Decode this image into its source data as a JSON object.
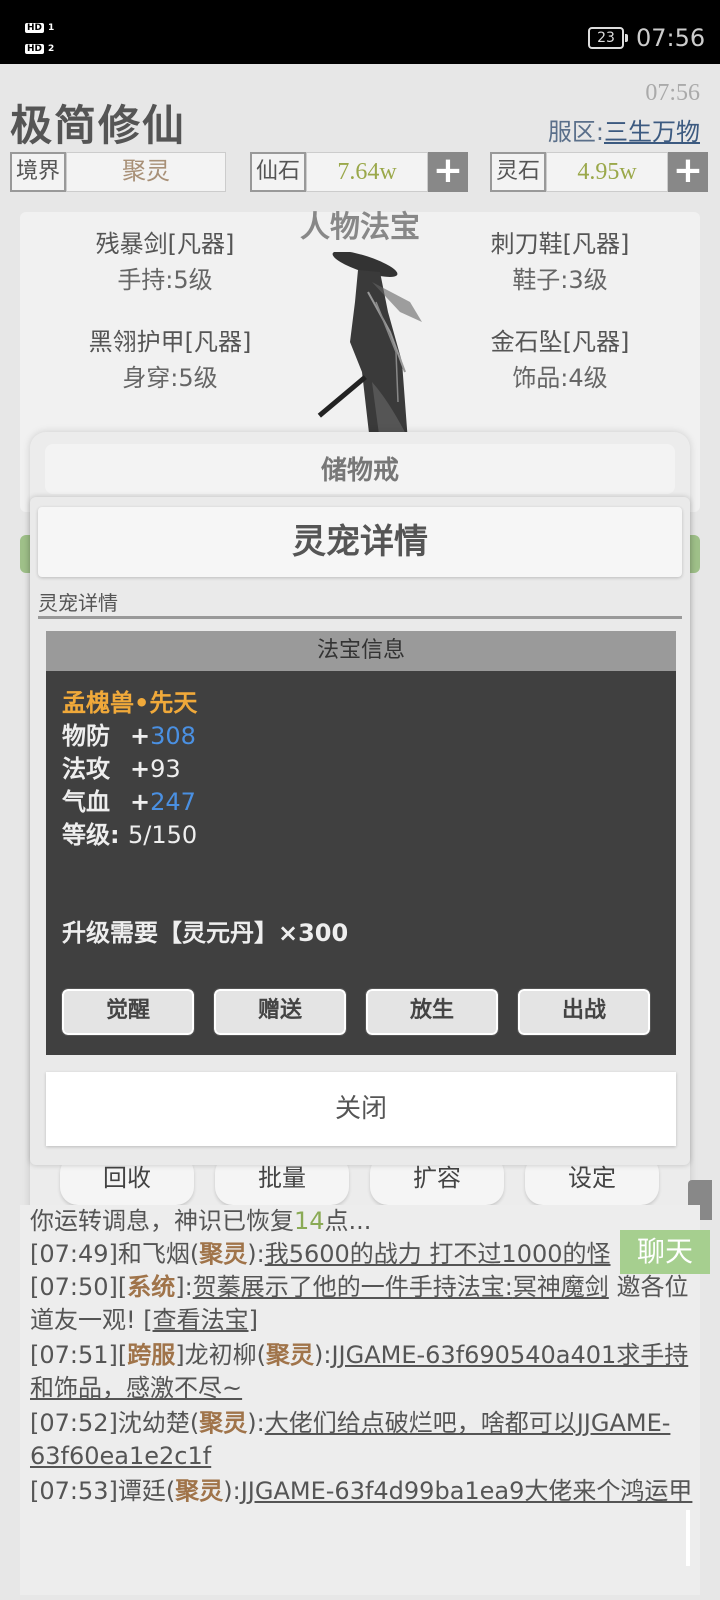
{
  "status_bar": {
    "hd1": "HD",
    "hd1_num": "1",
    "hd2": "HD",
    "hd2_num": "2",
    "battery": "23",
    "time": "07:56"
  },
  "header": {
    "app_title": "极简修仙",
    "clock": "07:56",
    "server_label": "服区:",
    "server_name": "三生万物"
  },
  "resources": {
    "realm_label": "境界",
    "realm_value": "聚灵",
    "xianshi_label": "仙石",
    "xianshi_value": "7.64w",
    "lingshi_label": "灵石",
    "lingshi_value": "4.95w",
    "plus": "+"
  },
  "equipment": {
    "title": "人物法宝",
    "slots": [
      {
        "name": "残暴剑[凡器]",
        "sub": "手持:5级"
      },
      {
        "name": "刺刀鞋[凡器]",
        "sub": "鞋子:3级"
      },
      {
        "name": "黑翎护甲[凡器]",
        "sub": "身穿:5级"
      },
      {
        "name": "金石坠[凡器]",
        "sub": "饰品:4级"
      }
    ]
  },
  "storage": {
    "title": "储物戒"
  },
  "pet_modal": {
    "title": "灵宠详情",
    "tab": "灵宠详情",
    "info_header": "法宝信息",
    "pet_name": "孟槐兽•先天",
    "stats": [
      {
        "label": "物防",
        "prefix": "+",
        "value": "308"
      },
      {
        "label": "法攻",
        "prefix": "+",
        "value": "93"
      },
      {
        "label": "气血",
        "prefix": "+",
        "value": "247"
      }
    ],
    "level_label": "等级:",
    "level_value": "5/150",
    "requirement": "升级需要【灵元丹】×300",
    "buttons": [
      "觉醒",
      "赠送",
      "放生",
      "出战"
    ],
    "close": "关闭"
  },
  "bottom_buttons": [
    "回收",
    "批量",
    "扩容",
    "设定"
  ],
  "chat": {
    "button": "聊天",
    "line0": {
      "pre": "你运转调息，神识已恢复",
      "num": "14",
      "post": "点..."
    },
    "line1": {
      "time": "[07:49]和飞烟(",
      "realm": "聚灵",
      "close": "):",
      "msg": "我5600的战力 打不过1000的怪"
    },
    "line2": {
      "time": "[07:50][",
      "tag": "系统",
      "close": "]:",
      "user": "贺蓁",
      "mid": "展示了他的一件手持法宝:",
      "item": "冥神魔剑",
      "rest": " 邀各位道友一观! ",
      "link": "[查看法宝]"
    },
    "line3": {
      "time": "[07:51][",
      "tag": "跨服",
      "close": "]龙初柳(",
      "realm": "聚灵",
      "close2": "):",
      "msg": "JJGAME-63f690540a401求手持和饰品，感激不尽~"
    },
    "line4": {
      "time": "[07:52]沈幼楚(",
      "realm": "聚灵",
      "close": "):",
      "msg": "大佬们给点破烂吧，啥都可以JJGAME-63f60ea1e2c1f"
    },
    "line5": {
      "time": "[07:53]谭廷(",
      "realm": "聚灵",
      "close": "):",
      "msg": "JJGAME-63f4d99ba1ea9大佬来个鸿运甲"
    }
  }
}
